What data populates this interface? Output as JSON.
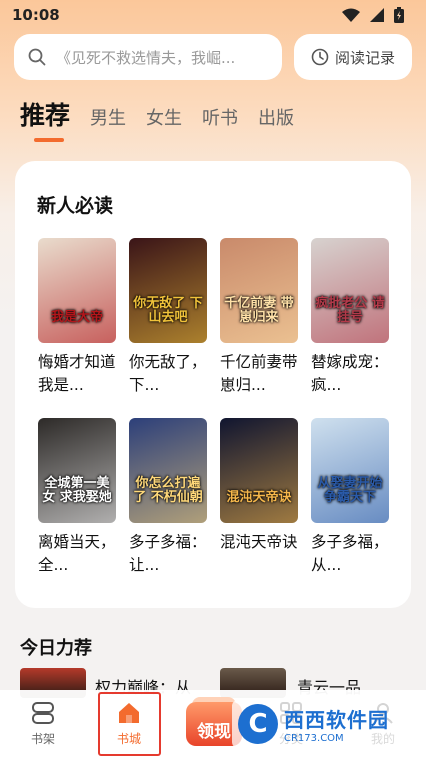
{
  "status": {
    "time": "10:08"
  },
  "search": {
    "placeholder": "《见死不救选情夫，我崛...",
    "history_label": "阅读记录"
  },
  "tabs": [
    {
      "label": "推荐",
      "active": true
    },
    {
      "label": "男生",
      "active": false
    },
    {
      "label": "女生",
      "active": false
    },
    {
      "label": "听书",
      "active": false
    },
    {
      "label": "出版",
      "active": false
    }
  ],
  "section_new": {
    "title": "新人必读",
    "books": [
      {
        "title": "悔婚才知道我是...",
        "cover_text": "我是大帝",
        "cover_color": "#e9dccd",
        "accent": "#b3161b"
      },
      {
        "title": "你无敌了，下...",
        "cover_text": "你无敌了 下山去吧",
        "cover_color": "#3a1418",
        "accent": "#f0c23a"
      },
      {
        "title": "千亿前妻带崽归...",
        "cover_text": "千亿前妻 带崽归来",
        "cover_color": "#c98a6b",
        "accent": "#ffe1a8"
      },
      {
        "title": "替嫁成宠：疯...",
        "cover_text": "疯批老公 请挂号",
        "cover_color": "#d7d2cf",
        "accent": "#b33a4a"
      },
      {
        "title": "离婚当天，全...",
        "cover_text": "全城第一美女 求我娶她",
        "cover_color": "#2d2a28",
        "accent": "#ffffff"
      },
      {
        "title": "多子多福：让...",
        "cover_text": "你怎么打遍了 不朽仙朝",
        "cover_color": "#2c3f7a",
        "accent": "#ffd97a"
      },
      {
        "title": "混沌天帝诀",
        "cover_text": "混沌天帝诀",
        "cover_color": "#101530",
        "accent": "#f5b74b"
      },
      {
        "title": "多子多福，从...",
        "cover_text": "从娶妻开始 争霸天下",
        "cover_color": "#cfe0ee",
        "accent": "#2a5aa8"
      }
    ]
  },
  "section_today": {
    "title": "今日力荐",
    "items": [
      {
        "title": "权力巅峰：从",
        "thumb_color": "#b53a2a"
      },
      {
        "title": "青云一品",
        "thumb_color": "#6a5a4a"
      }
    ]
  },
  "bottom_nav": [
    {
      "label": "书架",
      "icon": "bookshelf-icon",
      "active": false
    },
    {
      "label": "书城",
      "icon": "home-icon",
      "active": true
    },
    {
      "label": "分类",
      "icon": "category-icon",
      "active": false
    },
    {
      "label": "我的",
      "icon": "profile-icon",
      "active": false
    }
  ],
  "promo": {
    "label": "领现"
  },
  "watermark": {
    "main": "西西软件园",
    "sub": "CR173.COM"
  },
  "colors": {
    "accent": "#f36b2e"
  }
}
